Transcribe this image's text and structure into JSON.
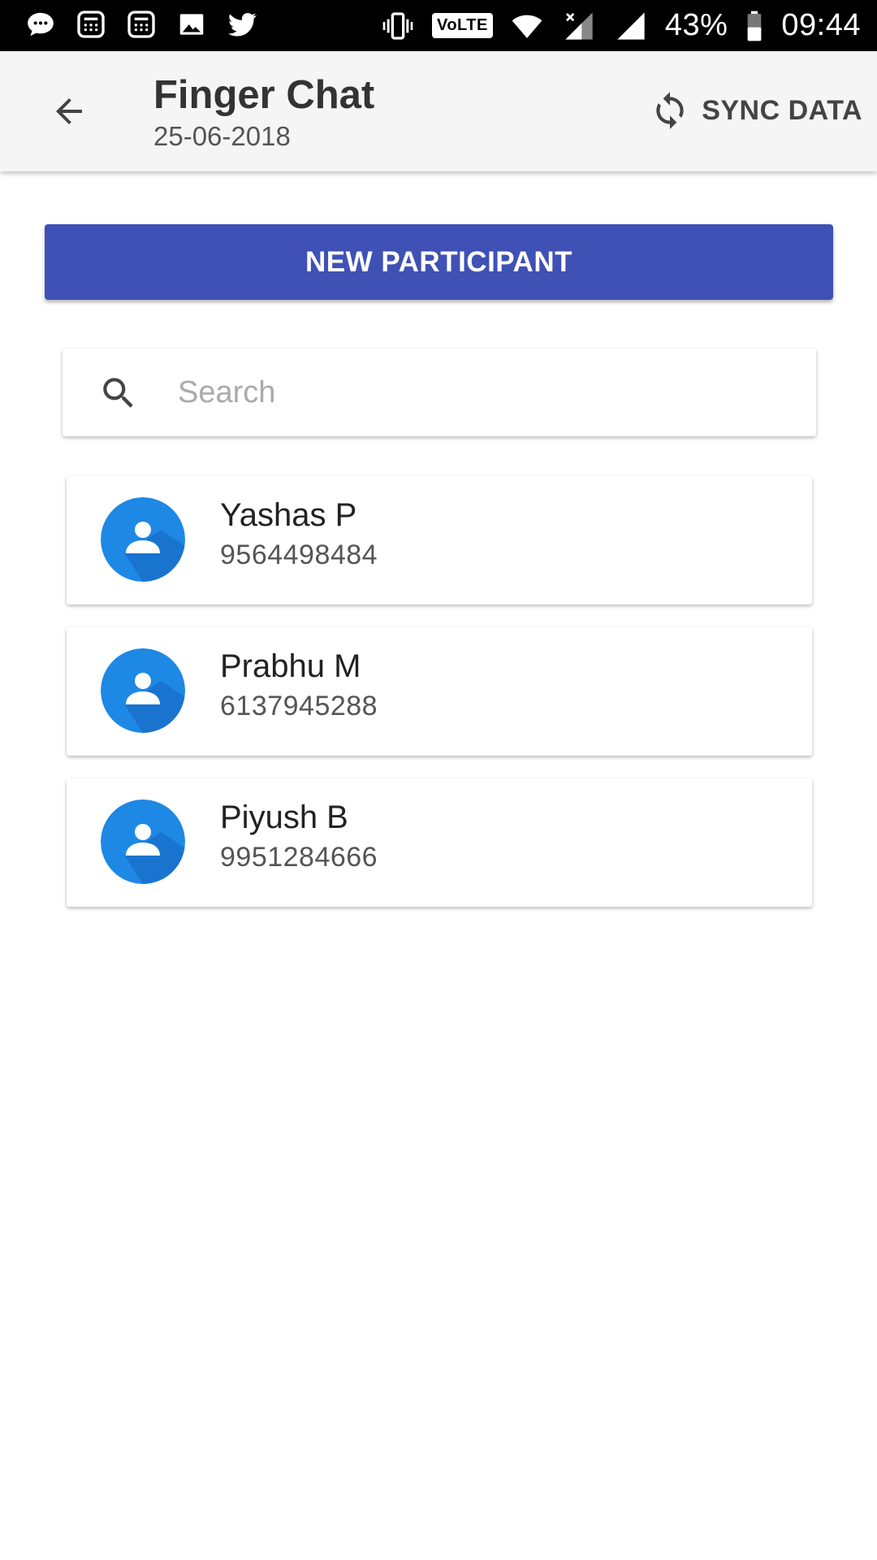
{
  "status_bar": {
    "battery": "43%",
    "time": "09:44",
    "network_badge": "VoLTE",
    "left_icons": [
      "chat-bubble-icon",
      "calculator-icon",
      "calculator-icon",
      "image-icon",
      "twitter-icon"
    ],
    "right_icons": [
      "vibrate-icon",
      "volte-icon",
      "wifi-icon",
      "signal-icon",
      "signal-icon",
      "battery-icon"
    ]
  },
  "app_bar": {
    "title": "Finger Chat",
    "date": "25-06-2018",
    "sync_label": "SYNC DATA",
    "back_icon": "arrow-back-icon",
    "sync_icon": "sync-icon"
  },
  "actions": {
    "new_participant_label": "NEW PARTICIPANT"
  },
  "search": {
    "placeholder": "Search",
    "value": ""
  },
  "participants": [
    {
      "name": "Yashas P",
      "phone": "9564498484"
    },
    {
      "name": "Prabhu M",
      "phone": "6137945288"
    },
    {
      "name": "Piyush B",
      "phone": "9951284666"
    }
  ],
  "colors": {
    "primary": "#3f51b5",
    "avatar": "#1e88e5",
    "status_bar": "#000000",
    "app_bar": "#f5f5f5"
  }
}
